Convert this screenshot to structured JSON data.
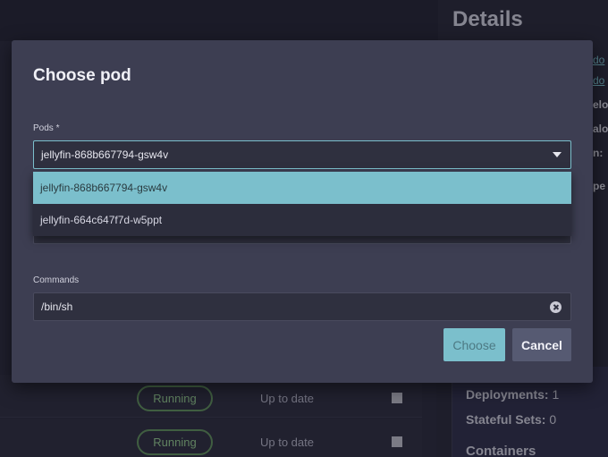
{
  "background": {
    "details_title": "Details",
    "rows": [
      {
        "status": "Running",
        "update": "Up to date"
      },
      {
        "status": "Running",
        "update": "Up to date"
      }
    ],
    "right_panel": {
      "deployments_label": "Deployments:",
      "deployments_value": "1",
      "stateful_sets_label": "Stateful Sets:",
      "stateful_sets_value": "0",
      "containers_heading": "Containers"
    },
    "edge_text": [
      "do",
      "do",
      "elo",
      "alo",
      "n:",
      "pe"
    ]
  },
  "dialog": {
    "title": "Choose pod",
    "pods_label": "Pods *",
    "pods_value": "jellyfin-868b667794-gsw4v",
    "pods_options": [
      "jellyfin-868b667794-gsw4v",
      "jellyfin-664c647f7d-w5ppt"
    ],
    "commands_label": "Commands",
    "commands_value": "/bin/sh",
    "choose_label": "Choose",
    "cancel_label": "Cancel"
  },
  "colors": {
    "accent": "#7bbfcc",
    "dialog_bg": "#3d3e52",
    "running_green": "#5f8c5b"
  }
}
